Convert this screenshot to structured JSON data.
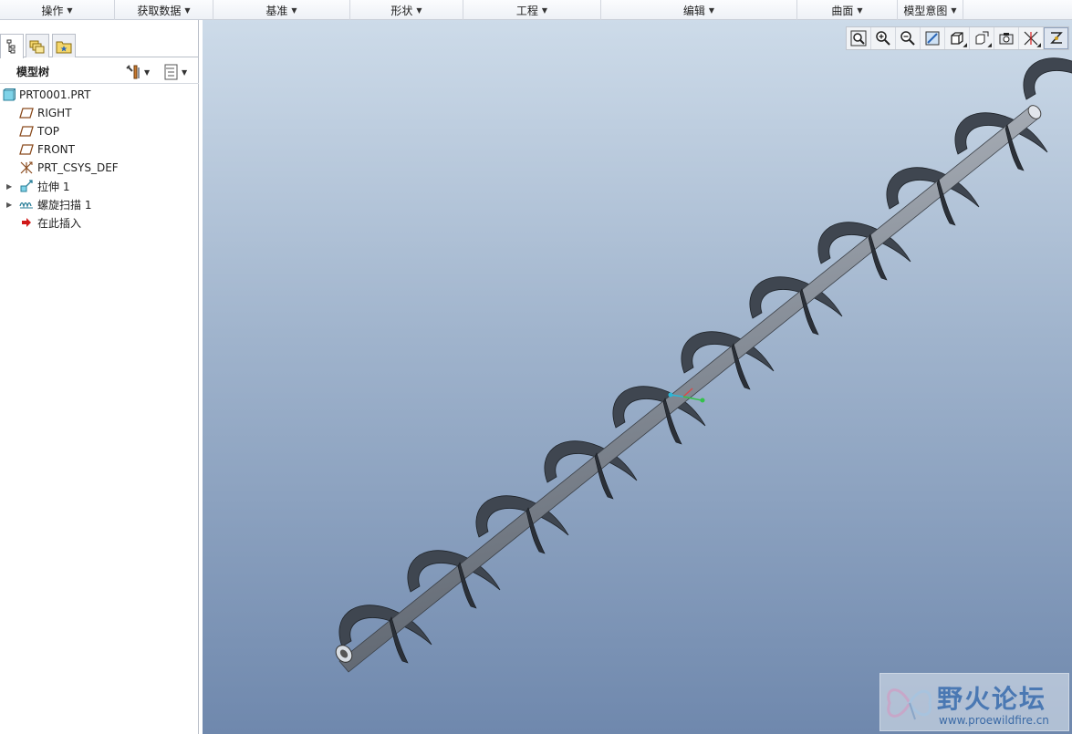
{
  "ribbon": {
    "groups": [
      {
        "label": "操作"
      },
      {
        "label": "获取数据"
      },
      {
        "label": "基准"
      },
      {
        "label": "形状"
      },
      {
        "label": "工程"
      },
      {
        "label": "编辑"
      },
      {
        "label": "曲面"
      },
      {
        "label": "模型意图"
      }
    ]
  },
  "model_tree": {
    "title": "模型树",
    "items": [
      {
        "label": "PRT0001.PRT",
        "icon": "part-icon"
      },
      {
        "label": "RIGHT",
        "icon": "datum-plane-icon"
      },
      {
        "label": "TOP",
        "icon": "datum-plane-icon"
      },
      {
        "label": "FRONT",
        "icon": "datum-plane-icon"
      },
      {
        "label": "PRT_CSYS_DEF",
        "icon": "coordinate-system-icon"
      },
      {
        "label": "拉伸 1",
        "icon": "extrude-icon"
      },
      {
        "label": "螺旋扫描 1",
        "icon": "helical-sweep-icon"
      },
      {
        "label": "在此插入",
        "icon": "insert-here-arrow-icon"
      }
    ]
  },
  "view_toolbar": {
    "buttons": [
      "refit-icon",
      "zoom-in-icon",
      "zoom-out-icon",
      "repaint-icon",
      "display-style-icon",
      "saved-views-icon",
      "view-manager-icon",
      "datum-display-icon",
      "spin-center-icon"
    ]
  },
  "watermark": {
    "text": "野火论坛",
    "url": "www.proewildfire.cn"
  },
  "colors": {
    "viewport_top": "#cddbe9",
    "viewport_bottom": "#6f88ad",
    "model_fill": "#3f4650",
    "shaft_fill": "#8a919b"
  }
}
